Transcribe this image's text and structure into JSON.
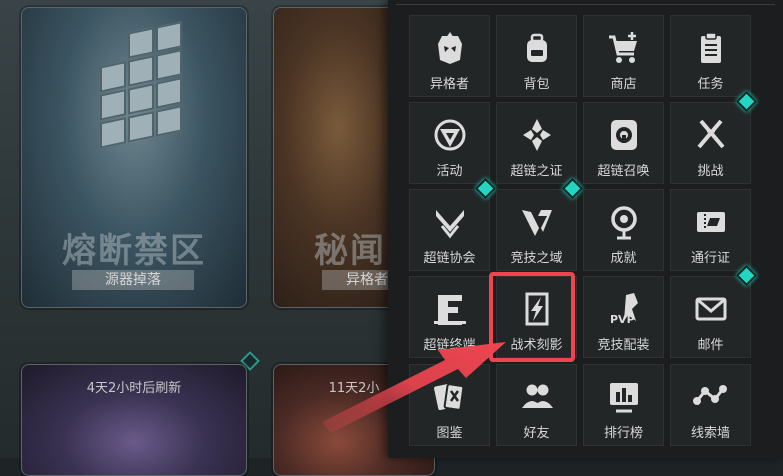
{
  "background": {
    "cards": [
      {
        "title": "熔断禁区",
        "subtitle": "源器掉落"
      },
      {
        "title": "秘闻",
        "subtitle": "异格者"
      }
    ],
    "refresh_cards": [
      {
        "text": "4天2小时后刷新"
      },
      {
        "text": "11天2小"
      }
    ]
  },
  "menu": {
    "items": [
      {
        "label": "异格者",
        "icon": "character-mask-icon",
        "badge": false
      },
      {
        "label": "背包",
        "icon": "backpack-icon",
        "badge": false
      },
      {
        "label": "商店",
        "icon": "shopping-cart-icon",
        "badge": false
      },
      {
        "label": "任务",
        "icon": "clipboard-icon",
        "badge": false
      },
      {
        "label": "活动",
        "icon": "activity-emblem-icon",
        "badge": false
      },
      {
        "label": "超链之证",
        "icon": "hyperlink-proof-icon",
        "badge": false
      },
      {
        "label": "超链召唤",
        "icon": "summon-icon",
        "badge": false
      },
      {
        "label": "挑战",
        "icon": "challenge-icon",
        "badge": true
      },
      {
        "label": "超链协会",
        "icon": "association-icon",
        "badge": true
      },
      {
        "label": "竞技之域",
        "icon": "arena-icon",
        "badge": true
      },
      {
        "label": "成就",
        "icon": "achievement-icon",
        "badge": false
      },
      {
        "label": "通行证",
        "icon": "pass-ticket-icon",
        "badge": false
      },
      {
        "label": "超链终端",
        "icon": "terminal-icon",
        "badge": false
      },
      {
        "label": "战术刻影",
        "icon": "tactical-engraving-icon",
        "badge": false
      },
      {
        "label": "竞技配装",
        "icon": "pvp-loadout-icon",
        "badge": false
      },
      {
        "label": "邮件",
        "icon": "mail-icon",
        "badge": true
      },
      {
        "label": "图鉴",
        "icon": "codex-cards-icon",
        "badge": false
      },
      {
        "label": "好友",
        "icon": "friends-icon",
        "badge": false
      },
      {
        "label": "排行榜",
        "icon": "leaderboard-icon",
        "badge": false
      },
      {
        "label": "线索墙",
        "icon": "clue-wall-icon",
        "badge": false
      }
    ],
    "highlighted_item": "战术刻影"
  },
  "colors": {
    "badge": "#23d6c2",
    "highlight": "#ee4550",
    "panel": "#1b1d1e"
  }
}
